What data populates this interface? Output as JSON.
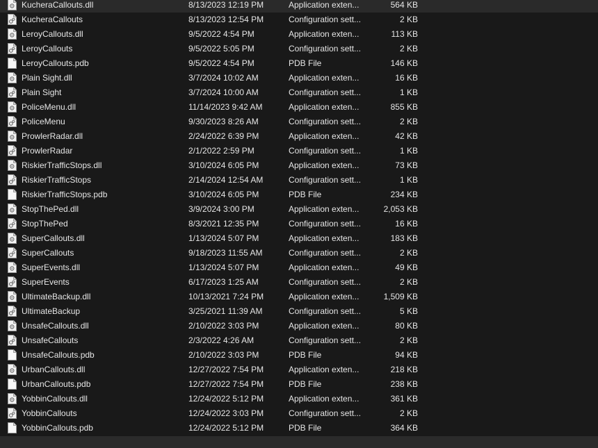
{
  "files": [
    {
      "name": "KucheraCallouts.dll",
      "date": "8/13/2023 12:19 PM",
      "type": "Application exten...",
      "size": "564 KB",
      "icon": "dll-file-icon"
    },
    {
      "name": "KucheraCallouts",
      "date": "8/13/2023 12:54 PM",
      "type": "Configuration sett...",
      "size": "2 KB",
      "icon": "config-file-icon"
    },
    {
      "name": "LeroyCallouts.dll",
      "date": "9/5/2022 4:54 PM",
      "type": "Application exten...",
      "size": "113 KB",
      "icon": "dll-file-icon"
    },
    {
      "name": "LeroyCallouts",
      "date": "9/5/2022 5:05 PM",
      "type": "Configuration sett...",
      "size": "2 KB",
      "icon": "config-file-icon"
    },
    {
      "name": "LeroyCallouts.pdb",
      "date": "9/5/2022 4:54 PM",
      "type": "PDB File",
      "size": "146 KB",
      "icon": "pdb-file-icon"
    },
    {
      "name": "Plain Sight.dll",
      "date": "3/7/2024 10:02 AM",
      "type": "Application exten...",
      "size": "16 KB",
      "icon": "dll-file-icon"
    },
    {
      "name": "Plain Sight",
      "date": "3/7/2024 10:00 AM",
      "type": "Configuration sett...",
      "size": "1 KB",
      "icon": "config-file-icon"
    },
    {
      "name": "PoliceMenu.dll",
      "date": "11/14/2023 9:42 AM",
      "type": "Application exten...",
      "size": "855 KB",
      "icon": "dll-file-icon"
    },
    {
      "name": "PoliceMenu",
      "date": "9/30/2023 8:26 AM",
      "type": "Configuration sett...",
      "size": "2 KB",
      "icon": "config-file-icon"
    },
    {
      "name": "ProwlerRadar.dll",
      "date": "2/24/2022 6:39 PM",
      "type": "Application exten...",
      "size": "42 KB",
      "icon": "dll-file-icon"
    },
    {
      "name": "ProwlerRadar",
      "date": "2/1/2022 2:59 PM",
      "type": "Configuration sett...",
      "size": "1 KB",
      "icon": "config-file-icon"
    },
    {
      "name": "RiskierTrafficStops.dll",
      "date": "3/10/2024 6:05 PM",
      "type": "Application exten...",
      "size": "73 KB",
      "icon": "dll-file-icon"
    },
    {
      "name": "RiskierTrafficStops",
      "date": "2/14/2024 12:54 AM",
      "type": "Configuration sett...",
      "size": "1 KB",
      "icon": "config-file-icon"
    },
    {
      "name": "RiskierTrafficStops.pdb",
      "date": "3/10/2024 6:05 PM",
      "type": "PDB File",
      "size": "234 KB",
      "icon": "pdb-file-icon"
    },
    {
      "name": "StopThePed.dll",
      "date": "3/9/2024 3:00 PM",
      "type": "Application exten...",
      "size": "2,053 KB",
      "icon": "dll-file-icon"
    },
    {
      "name": "StopThePed",
      "date": "8/3/2021 12:35 PM",
      "type": "Configuration sett...",
      "size": "16 KB",
      "icon": "config-file-icon"
    },
    {
      "name": "SuperCallouts.dll",
      "date": "1/13/2024 5:07 PM",
      "type": "Application exten...",
      "size": "183 KB",
      "icon": "dll-file-icon"
    },
    {
      "name": "SuperCallouts",
      "date": "9/18/2023 11:55 AM",
      "type": "Configuration sett...",
      "size": "2 KB",
      "icon": "config-file-icon"
    },
    {
      "name": "SuperEvents.dll",
      "date": "1/13/2024 5:07 PM",
      "type": "Application exten...",
      "size": "49 KB",
      "icon": "dll-file-icon"
    },
    {
      "name": "SuperEvents",
      "date": "6/17/2023 1:25 AM",
      "type": "Configuration sett...",
      "size": "2 KB",
      "icon": "config-file-icon"
    },
    {
      "name": "UltimateBackup.dll",
      "date": "10/13/2021 7:24 PM",
      "type": "Application exten...",
      "size": "1,509 KB",
      "icon": "dll-file-icon"
    },
    {
      "name": "UltimateBackup",
      "date": "3/25/2021 11:39 AM",
      "type": "Configuration sett...",
      "size": "5 KB",
      "icon": "config-file-icon"
    },
    {
      "name": "UnsafeCallouts.dll",
      "date": "2/10/2022 3:03 PM",
      "type": "Application exten...",
      "size": "80 KB",
      "icon": "dll-file-icon"
    },
    {
      "name": "UnsafeCallouts",
      "date": "2/3/2022 4:26 AM",
      "type": "Configuration sett...",
      "size": "2 KB",
      "icon": "config-file-icon"
    },
    {
      "name": "UnsafeCallouts.pdb",
      "date": "2/10/2022 3:03 PM",
      "type": "PDB File",
      "size": "94 KB",
      "icon": "pdb-file-icon"
    },
    {
      "name": "UrbanCallouts.dll",
      "date": "12/27/2022 7:54 PM",
      "type": "Application exten...",
      "size": "218 KB",
      "icon": "dll-file-icon"
    },
    {
      "name": "UrbanCallouts.pdb",
      "date": "12/27/2022 7:54 PM",
      "type": "PDB File",
      "size": "238 KB",
      "icon": "pdb-file-icon"
    },
    {
      "name": "YobbinCallouts.dll",
      "date": "12/24/2022 5:12 PM",
      "type": "Application exten...",
      "size": "361 KB",
      "icon": "dll-file-icon"
    },
    {
      "name": "YobbinCallouts",
      "date": "12/24/2022 3:03 PM",
      "type": "Configuration sett...",
      "size": "2 KB",
      "icon": "config-file-icon"
    },
    {
      "name": "YobbinCallouts.pdb",
      "date": "12/24/2022 5:12 PM",
      "type": "PDB File",
      "size": "364 KB",
      "icon": "pdb-file-icon"
    }
  ],
  "colors": {
    "background": "#191919",
    "text": "#e6e6e6",
    "scrollbar": "#2b2b2b"
  }
}
